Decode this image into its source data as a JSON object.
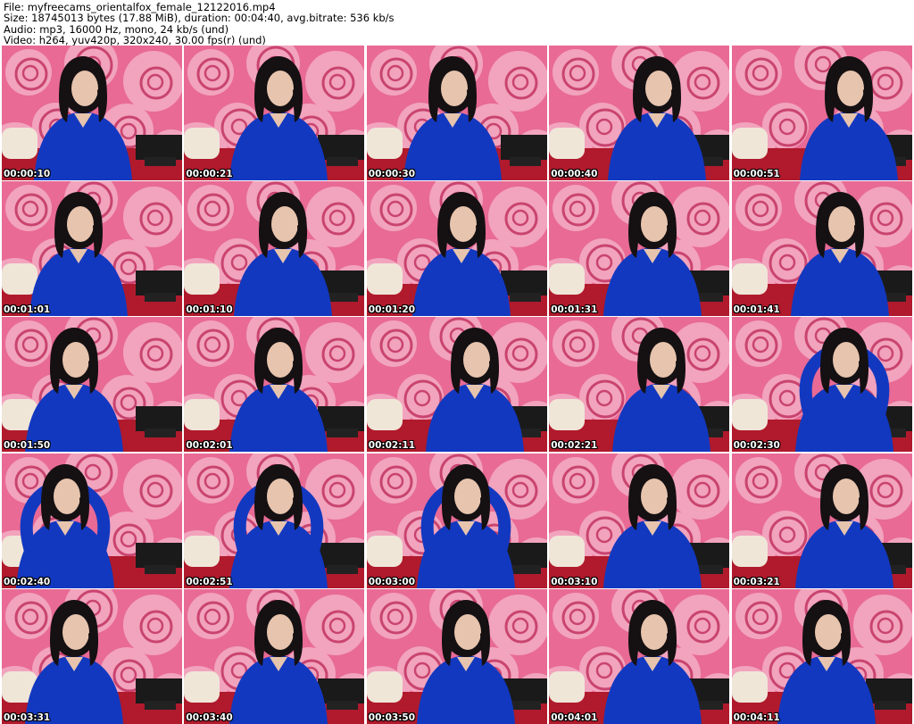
{
  "info": {
    "file": "File: myfreecams_orientalfox_female_12122016.mp4",
    "size": "Size: 18745013 bytes (17.88 MiB), duration: 00:04:40, avg.bitrate: 536 kb/s",
    "audio": "Audio: mp3, 16000 Hz, mono, 24 kb/s (und)",
    "video": "Video: h264, yuv420p, 320x240, 30.00 fps(r) (und)"
  },
  "thumbnails": [
    "00:00:10",
    "00:00:21",
    "00:00:30",
    "00:00:40",
    "00:00:51",
    "00:01:01",
    "00:01:10",
    "00:01:20",
    "00:01:31",
    "00:01:41",
    "00:01:50",
    "00:02:01",
    "00:02:11",
    "00:02:21",
    "00:02:30",
    "00:02:40",
    "00:02:51",
    "00:03:00",
    "00:03:10",
    "00:03:21",
    "00:03:31",
    "00:03:40",
    "00:03:50",
    "00:04:01",
    "00:04:11"
  ],
  "colors": {
    "wallpaper": "#e86a95",
    "rose": "#f2a3bd",
    "rose_dark": "#c9446f",
    "sweater": "#1238c0",
    "hair": "#151012",
    "skin": "#e7c4ad",
    "carpet": "#b01a2c",
    "sofa": "#efe6d8"
  },
  "icons": [
    "rose-wallpaper",
    "person-in-blue-sweater"
  ]
}
